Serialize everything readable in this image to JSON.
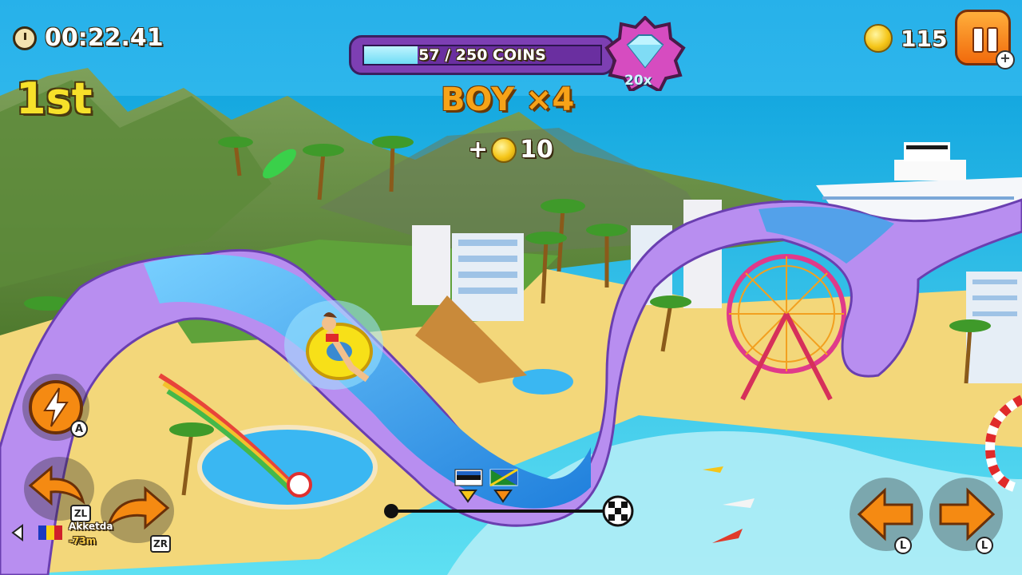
{
  "hud": {
    "timer": "00:22.41",
    "place": "1st",
    "coins_total": "115",
    "progress": {
      "label": "57 / 250 COINS",
      "collected": 57,
      "goal": 250,
      "multiplier": "20x"
    },
    "combo_text": "BOY ×4",
    "bonus_text": "+",
    "bonus_amount": "10"
  },
  "controls": {
    "boost_key": "A",
    "left_spin_key": "ZL",
    "right_spin_key": "ZR",
    "steer_left_key": "L",
    "steer_right_key": "L"
  },
  "rival": {
    "name": "Akketda",
    "distance": "-73m"
  },
  "race_progress": {
    "player_position": 0.0,
    "rival_position": 0.16
  },
  "colors": {
    "accent_orange": "#f16a0c",
    "slide_purple": "#b88ef0",
    "water_blue": "#3aa6e8",
    "gem_pink": "#d64cc0",
    "place_yellow": "#f7e12a"
  },
  "icons": {
    "timer": "stopwatch-icon",
    "coins": "coin-icon",
    "pause": "pause-icon",
    "boost": "lightning-icon",
    "finish": "checkered-flag-icon"
  }
}
